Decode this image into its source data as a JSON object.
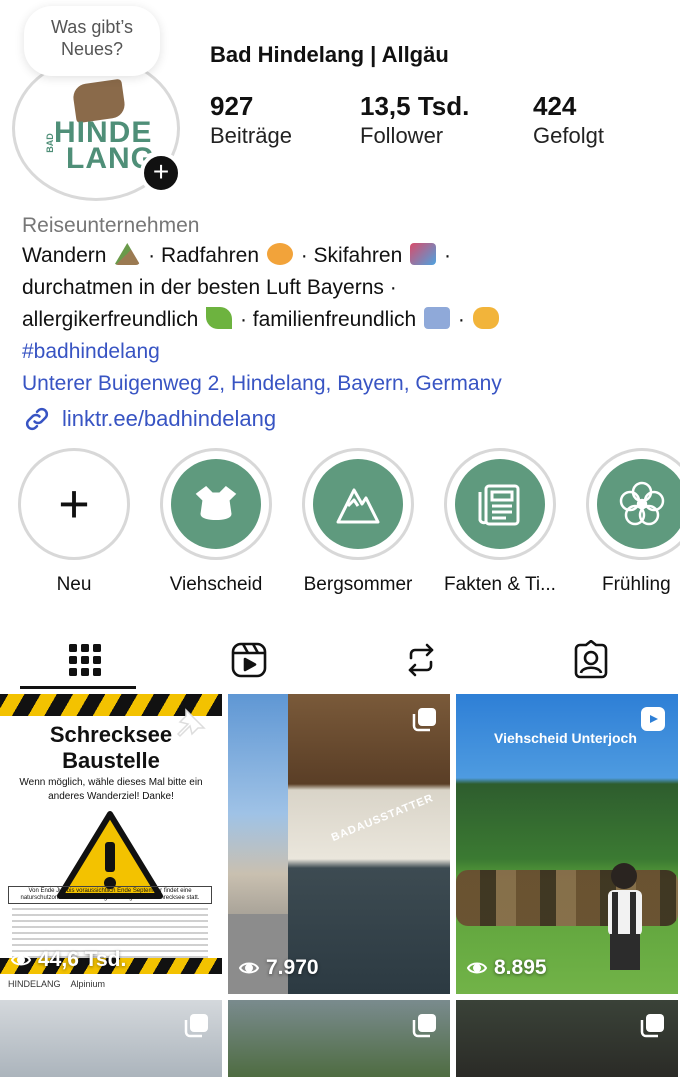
{
  "note": {
    "text": "Was gibt’s Neues?"
  },
  "profile": {
    "name": "Bad Hindelang | Allgäu",
    "logo_text_top": "HINDE",
    "logo_text_bottom": "LANG",
    "logo_side": "BAD",
    "stats": [
      {
        "value": "927",
        "label": "Beiträge"
      },
      {
        "value": "13,5 Tsd.",
        "label": "Follower"
      },
      {
        "value": "424",
        "label": "Gefolgt"
      }
    ]
  },
  "bio": {
    "category": "Reiseunternehmen",
    "lines": [
      "Wandern",
      "· Radfahren",
      "· Skifahren",
      "·",
      "durchatmen in der besten Luft Bayerns ·",
      "allergikerfreundlich",
      "· familienfreundlich",
      "·"
    ],
    "hashtag": "#badhindelang",
    "address": "Unterer Buigenweg 2, Hindelang, Bayern, Germany",
    "link": "linktr.ee/badhindelang"
  },
  "highlights": [
    {
      "label": "Neu",
      "icon": "plus-icon"
    },
    {
      "label": "Viehscheid",
      "icon": "cow-icon"
    },
    {
      "label": "Bergsommer",
      "icon": "mountain-icon"
    },
    {
      "label": "Fakten & Ti...",
      "icon": "newspaper-icon"
    },
    {
      "label": "Frühling",
      "icon": "flower-icon"
    }
  ],
  "tabs": [
    {
      "name": "grid",
      "icon": "grid-icon"
    },
    {
      "name": "reels",
      "icon": "reels-icon"
    },
    {
      "name": "reposts",
      "icon": "repost-icon"
    },
    {
      "name": "tagged",
      "icon": "tagged-icon"
    }
  ],
  "posts": [
    {
      "views": "44,6 Tsd.",
      "title": "Schrecksee Baustelle",
      "subtitle": "Wenn möglich, wähle dieses Mal bitte ein anderes Wanderziel! Danke!",
      "notice": "Von Ende Juli bis voraussichtlich Ende September findet eine naturschutzorientierte Sanierung des Weges zum Schrecksee statt.",
      "footer_1": "HINDELANG",
      "footer_2": "Alpinium"
    },
    {
      "views": "7.970",
      "sign": "BADAUSSTATTER"
    },
    {
      "views": "8.895",
      "caption": "Viehscheid Unterjoch"
    },
    {
      "views": ""
    },
    {
      "views": ""
    },
    {
      "views": ""
    }
  ],
  "colors": {
    "accent_green": "#5f9a7e",
    "link_blue": "#3854c3",
    "warning_yellow": "#f3c200"
  }
}
